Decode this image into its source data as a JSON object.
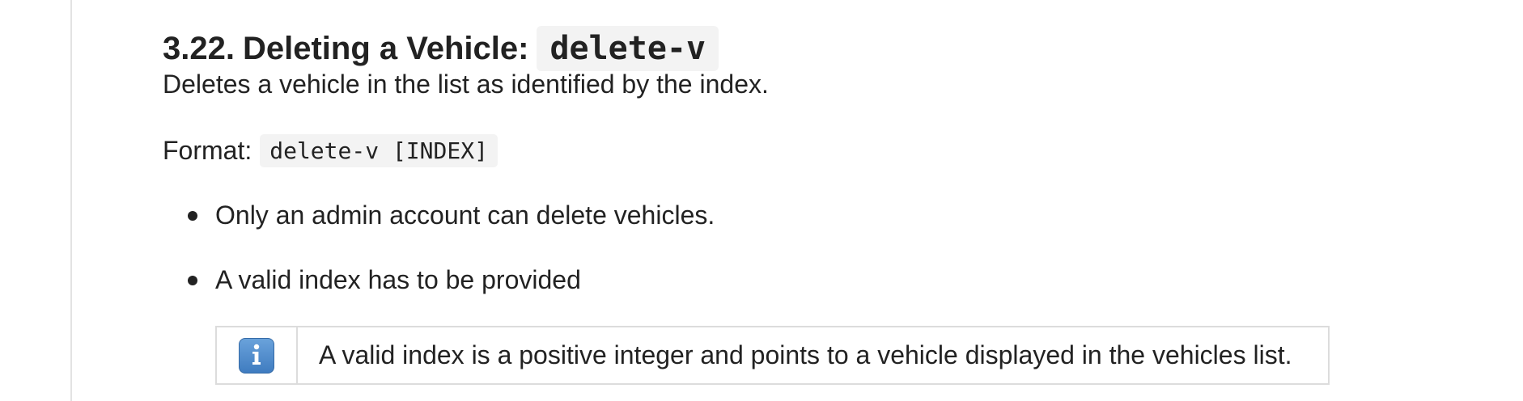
{
  "section": {
    "number": "3.22.",
    "title": "Deleting a Vehicle:",
    "command": "delete-v"
  },
  "description": "Deletes a vehicle in the list as identified by the index.",
  "format": {
    "label": "Format:",
    "code": "delete-v [INDEX]"
  },
  "bullets": [
    "Only an admin account can delete vehicles.",
    "A valid index has to be provided"
  ],
  "note": {
    "icon": "info-icon",
    "text": "A valid index is a positive integer and points to a vehicle displayed in the vehicles list."
  }
}
